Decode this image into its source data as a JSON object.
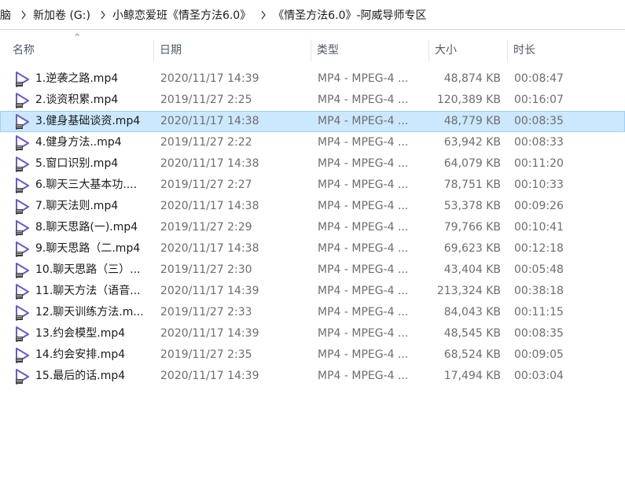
{
  "breadcrumb": [
    "电脑",
    "新加卷 (G:)",
    "小鲸恋爱班《情圣方法6.0》",
    "《情圣方法6.0》-阿威导师专区"
  ],
  "columns": {
    "name": "名称",
    "date": "日期",
    "type": "类型",
    "size": "大小",
    "duration": "时长"
  },
  "sort_indicator": "^",
  "files": [
    {
      "name": "1.逆袭之路.mp4",
      "date": "2020/11/17 14:39",
      "type": "MP4 - MPEG-4 ...",
      "size": "48,874 KB",
      "duration": "00:08:47",
      "selected": false
    },
    {
      "name": "2.谈资积累.mp4",
      "date": "2019/11/27 2:25",
      "type": "MP4 - MPEG-4 ...",
      "size": "120,389 KB",
      "duration": "00:16:07",
      "selected": false
    },
    {
      "name": "3.健身基础谈资.mp4",
      "date": "2020/11/17 14:38",
      "type": "MP4 - MPEG-4 ...",
      "size": "48,779 KB",
      "duration": "00:08:35",
      "selected": true
    },
    {
      "name": "4.健身方法..mp4",
      "date": "2019/11/27 2:22",
      "type": "MP4 - MPEG-4 ...",
      "size": "63,942 KB",
      "duration": "00:08:33",
      "selected": false
    },
    {
      "name": "5.窗口识别.mp4",
      "date": "2020/11/17 14:38",
      "type": "MP4 - MPEG-4 ...",
      "size": "64,079 KB",
      "duration": "00:11:20",
      "selected": false
    },
    {
      "name": "6.聊天三大基本功....",
      "date": "2019/11/27 2:27",
      "type": "MP4 - MPEG-4 ...",
      "size": "78,751 KB",
      "duration": "00:10:33",
      "selected": false
    },
    {
      "name": "7.聊天法则.mp4",
      "date": "2020/11/17 14:38",
      "type": "MP4 - MPEG-4 ...",
      "size": "53,378 KB",
      "duration": "00:09:26",
      "selected": false
    },
    {
      "name": "8.聊天思路(一).mp4",
      "date": "2019/11/27 2:29",
      "type": "MP4 - MPEG-4 ...",
      "size": "79,766 KB",
      "duration": "00:10:41",
      "selected": false
    },
    {
      "name": "9.聊天思路（二.mp4",
      "date": "2020/11/17 14:38",
      "type": "MP4 - MPEG-4 ...",
      "size": "69,623 KB",
      "duration": "00:12:18",
      "selected": false
    },
    {
      "name": "10.聊天思路（三）...",
      "date": "2019/11/27 2:30",
      "type": "MP4 - MPEG-4 ...",
      "size": "43,404 KB",
      "duration": "00:05:48",
      "selected": false
    },
    {
      "name": "11.聊天方法（语音...",
      "date": "2020/11/17 14:39",
      "type": "MP4 - MPEG-4 ...",
      "size": "213,324 KB",
      "duration": "00:38:18",
      "selected": false
    },
    {
      "name": "12.聊天训练方法.m...",
      "date": "2019/11/27 2:33",
      "type": "MP4 - MPEG-4 ...",
      "size": "84,043 KB",
      "duration": "00:11:15",
      "selected": false
    },
    {
      "name": "13.约会模型.mp4",
      "date": "2020/11/17 14:39",
      "type": "MP4 - MPEG-4 ...",
      "size": "48,545 KB",
      "duration": "00:08:35",
      "selected": false
    },
    {
      "name": "14.约会安排.mp4",
      "date": "2019/11/27 2:35",
      "type": "MP4 - MPEG-4 ...",
      "size": "68,524 KB",
      "duration": "00:09:05",
      "selected": false
    },
    {
      "name": "15.最后的话.mp4",
      "date": "2020/11/17 14:39",
      "type": "MP4 - MPEG-4 ...",
      "size": "17,494 KB",
      "duration": "00:03:04",
      "selected": false
    }
  ],
  "icon": {
    "name": "video-file-icon",
    "color": "#6a5acd"
  }
}
